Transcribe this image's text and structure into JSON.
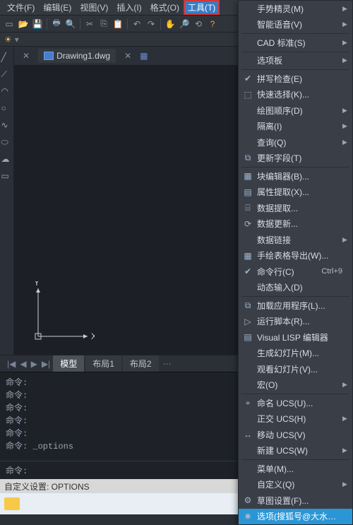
{
  "menubar": [
    "文件(F)",
    "编辑(E)",
    "视图(V)",
    "插入(I)",
    "格式(O)",
    "工具(T)"
  ],
  "menubar_active_index": 5,
  "doc": {
    "name": "Drawing1.dwg"
  },
  "tabs": {
    "nav": [
      "|◀",
      "◀",
      "▶",
      "▶|"
    ],
    "items": [
      "模型",
      "布局1",
      "布局2"
    ],
    "active": 0
  },
  "cmdhist": [
    "命令:",
    "命令:",
    "命令:",
    "命令:",
    "命令:",
    "命令: _options"
  ],
  "cmdline": {
    "prompt": "命令:",
    "value": ""
  },
  "status": "自定义设置: OPTIONS",
  "axis": {
    "x": "X",
    "y": "Y"
  },
  "dropdown": [
    {
      "label": "手势精灵(M)",
      "sub": true
    },
    {
      "label": "智能语音(V)",
      "sub": true
    },
    {
      "sep": true
    },
    {
      "label": "CAD 标准(S)",
      "sub": true
    },
    {
      "sep": true
    },
    {
      "label": "选项板",
      "sub": true
    },
    {
      "sep": true
    },
    {
      "label": "拼写检查(E)",
      "icon": "check"
    },
    {
      "label": "快速选择(K)...",
      "icon": "select"
    },
    {
      "label": "绘图顺序(D)",
      "sub": true
    },
    {
      "label": "隔离(I)",
      "sub": true
    },
    {
      "label": "查询(Q)",
      "sub": true
    },
    {
      "label": "更新字段(T)",
      "icon": "field"
    },
    {
      "sep": true
    },
    {
      "label": "块编辑器(B)...",
      "icon": "block"
    },
    {
      "label": "属性提取(X)...",
      "icon": "attr"
    },
    {
      "label": "数据提取...",
      "icon": "data"
    },
    {
      "label": "数据更新...",
      "icon": "refresh"
    },
    {
      "label": "数据链接",
      "sub": true
    },
    {
      "label": "手绘表格导出(W)...",
      "icon": "table"
    },
    {
      "label": "命令行(C)",
      "shortcut": "Ctrl+9",
      "icon": "cmd"
    },
    {
      "label": "动态输入(D)"
    },
    {
      "sep": true
    },
    {
      "label": "加载应用程序(L)...",
      "icon": "app"
    },
    {
      "label": "运行脚本(R)...",
      "icon": "script"
    },
    {
      "label": "Visual LISP 编辑器",
      "icon": "lisp"
    },
    {
      "label": "生成幻灯片(M)..."
    },
    {
      "label": "观看幻灯片(V)..."
    },
    {
      "label": "宏(O)",
      "sub": true
    },
    {
      "sep": true
    },
    {
      "label": "命名 UCS(U)...",
      "icon": "ucs"
    },
    {
      "label": "正交 UCS(H)",
      "sub": true
    },
    {
      "label": "移动 UCS(V)",
      "icon": "move"
    },
    {
      "label": "新建 UCS(W)",
      "sub": true
    },
    {
      "sep": true
    },
    {
      "label": "菜单(M)..."
    },
    {
      "label": "自定义(Q)",
      "sub": true
    },
    {
      "label": "草图设置(F)...",
      "icon": "draft"
    },
    {
      "label": "选项(搜狐号@大水牛测绘",
      "icon": "gear",
      "hl": true
    }
  ]
}
